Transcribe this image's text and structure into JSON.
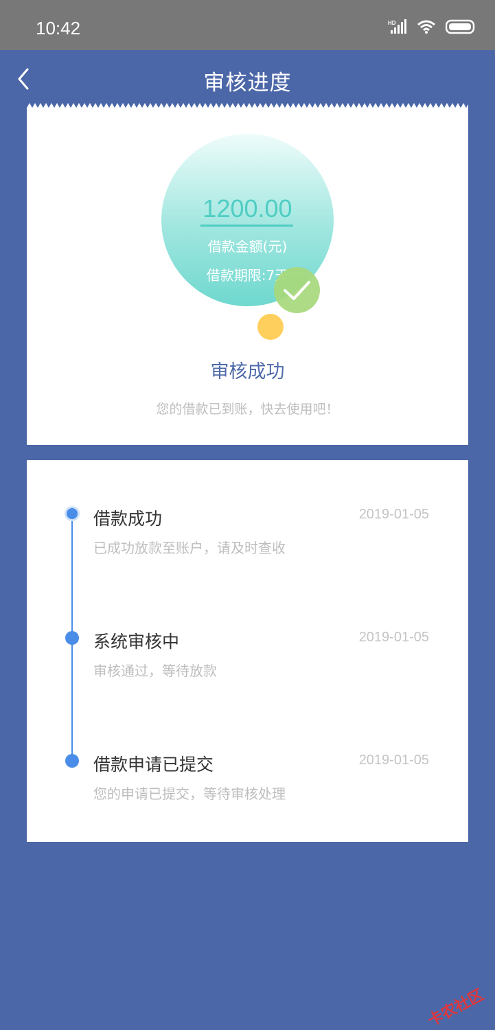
{
  "status_bar": {
    "time": "10:42",
    "icons": [
      "hd-signal-icon",
      "wifi-icon",
      "battery-icon"
    ]
  },
  "navbar": {
    "title": "审核进度",
    "back_icon": "chevron-left-icon"
  },
  "summary": {
    "amount": "1200.00",
    "amount_label": "借款金额(元)",
    "term_label": "借款期限:7天",
    "status_title": "审核成功",
    "status_subtitle": "您的借款已到账，快去使用吧！",
    "colors": {
      "accent_teal": "#4fcdc3",
      "check_green": "#a8d97c",
      "dot_yellow": "#fecf5c",
      "title_blue": "#4e6aa9"
    }
  },
  "timeline": {
    "items": [
      {
        "title": "借款成功",
        "date": "2019-01-05",
        "desc": "已成功放款至账户，请及时查收"
      },
      {
        "title": "系统审核中",
        "date": "2019-01-05",
        "desc": "审核通过，等待放款"
      },
      {
        "title": "借款申请已提交",
        "date": "2019-01-05",
        "desc": "您的申请已提交，等待审核处理"
      }
    ],
    "line_color": "#4a8de8"
  },
  "watermark": {
    "text": "卡农社区"
  }
}
